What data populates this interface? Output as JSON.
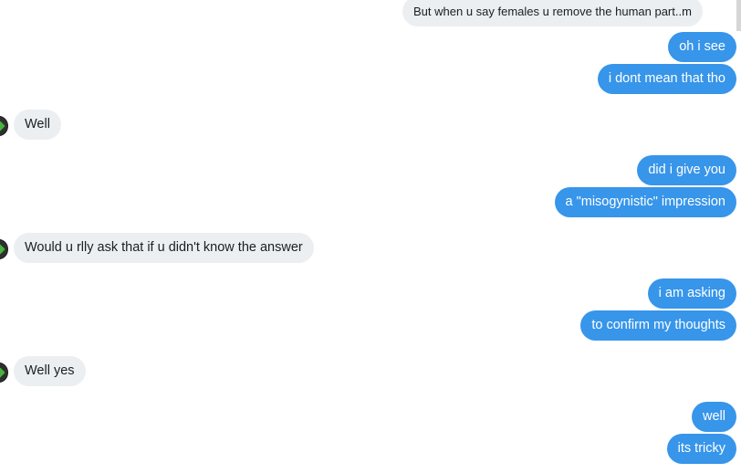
{
  "messages": [
    {
      "from": "them",
      "text": "But when u say females u remove the human part..m"
    },
    {
      "from": "me",
      "text": "oh i see"
    },
    {
      "from": "me",
      "text": "i dont mean that tho"
    },
    {
      "from": "them",
      "text": "Well"
    },
    {
      "from": "me",
      "text": "did i give you"
    },
    {
      "from": "me",
      "text": "a \"misogynistic\" impression"
    },
    {
      "from": "them",
      "text": "Would u rlly ask that if u didn't know the answer"
    },
    {
      "from": "me",
      "text": "i am asking"
    },
    {
      "from": "me",
      "text": "to confirm my thoughts"
    },
    {
      "from": "them",
      "text": "Well yes"
    },
    {
      "from": "me",
      "text": "well"
    },
    {
      "from": "me",
      "text": "its tricky"
    }
  ],
  "colors": {
    "outgoing_bubble": "#3795ea",
    "incoming_bubble": "#eceff1",
    "avatar_icon": "#46b33a"
  },
  "icons": {
    "contact_avatar": "contact-avatar-icon"
  }
}
